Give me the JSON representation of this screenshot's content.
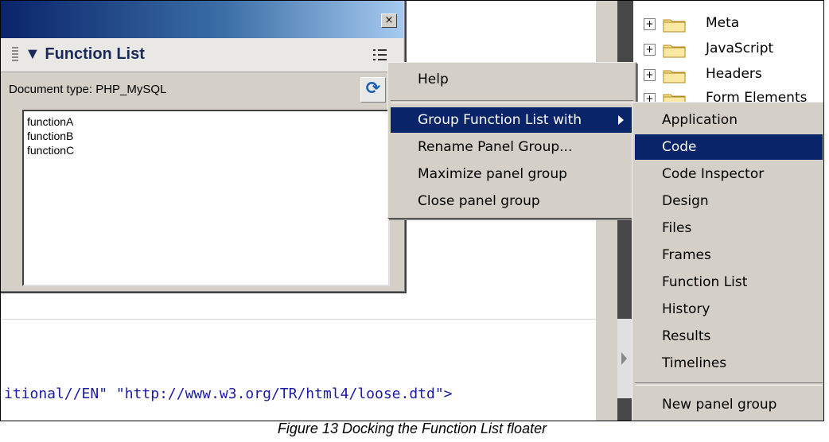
{
  "panel": {
    "close_glyph": "×",
    "title": "▼ Function List",
    "doc_type_label": "Document type: PHP_MySQL",
    "refresh_glyph": "⟳",
    "functions": [
      "functionA",
      "functionB",
      "functionC"
    ]
  },
  "code_line": "itional//EN\" \"http://www.w3.org/TR/html4/loose.dtd\">",
  "tree": [
    "Meta",
    "JavaScript",
    "Headers",
    "Form Elements"
  ],
  "context_menu": {
    "items": [
      "Help",
      "Group Function List with",
      "Rename Panel Group...",
      "Maximize panel group",
      "Close panel group"
    ]
  },
  "submenu": {
    "items": [
      "Application",
      "Code",
      "Code Inspector",
      "Design",
      "Files",
      "Frames",
      "Function List",
      "History",
      "Results",
      "Timelines"
    ],
    "new_group": "New panel group",
    "selected": "Code"
  },
  "colors": {
    "selection": "#0a246a",
    "title_gradient_start": "#0a246a"
  },
  "caption": "Figure 13 Docking the Function List floater"
}
